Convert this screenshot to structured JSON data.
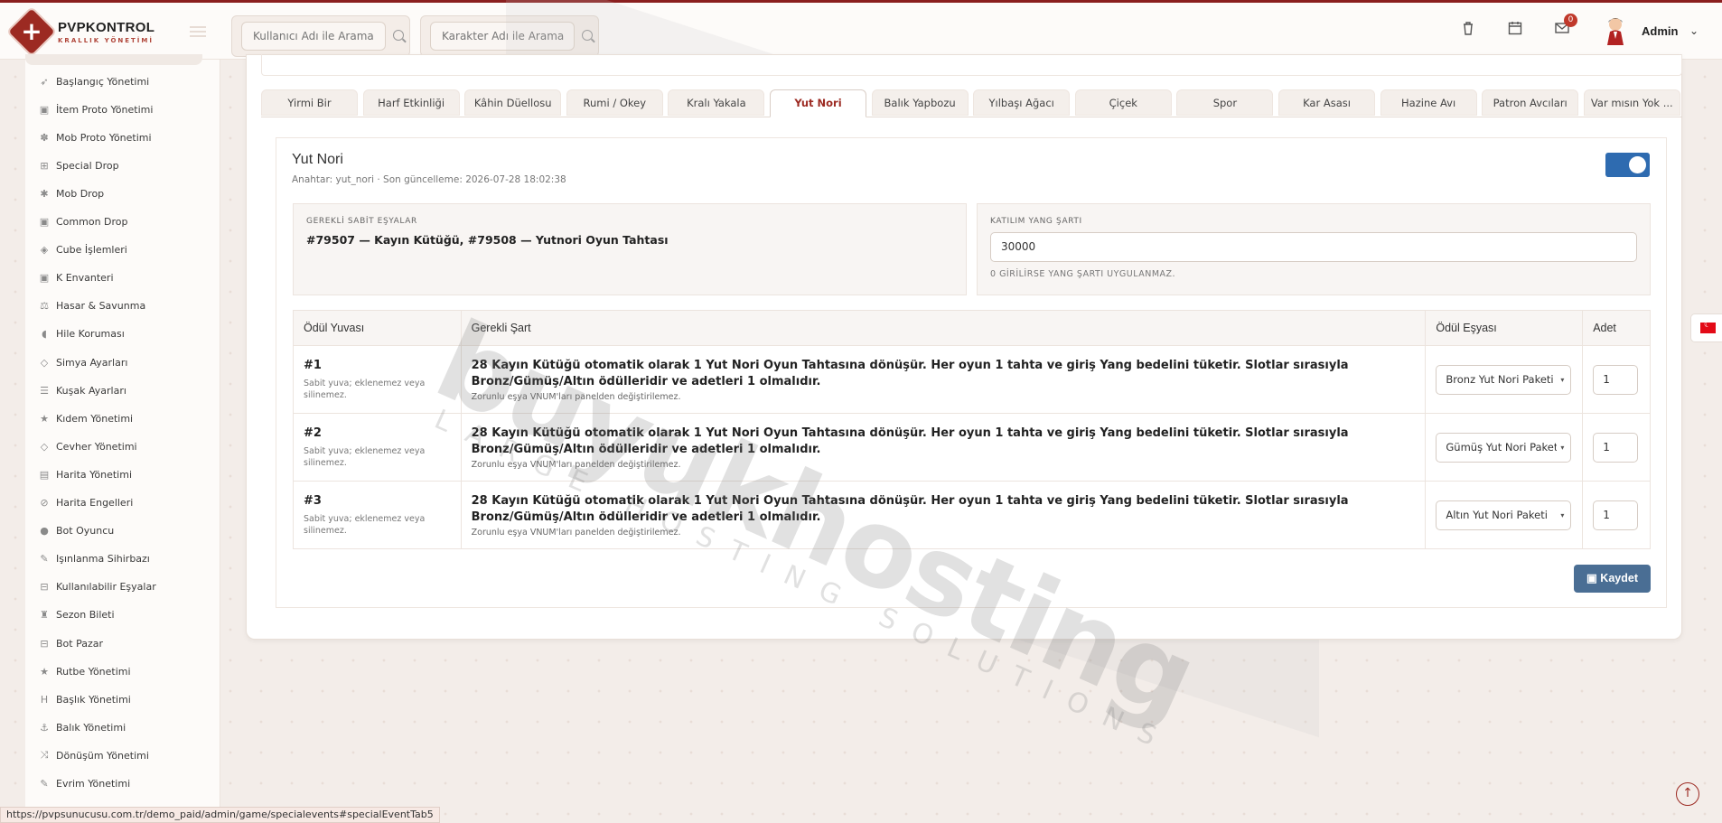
{
  "brand": {
    "title": "PVPKONTROL",
    "subtitle": "KRALLIK YÖNETİMİ"
  },
  "header": {
    "search_user_placeholder": "Kullanıcı Adı ile Arama",
    "search_char_placeholder": "Karakter Adı ile Arama",
    "notification_count": "0",
    "admin_name": "Admin"
  },
  "sidebar": {
    "items": [
      {
        "label": "Başlangıç Yönetimi",
        "icon": "rocket-icon"
      },
      {
        "label": "İtem Proto Yönetimi",
        "icon": "box-icon"
      },
      {
        "label": "Mob Proto Yönetimi",
        "icon": "paw-icon"
      },
      {
        "label": "Special Drop",
        "icon": "gift-icon"
      },
      {
        "label": "Mob Drop",
        "icon": "bug-icon"
      },
      {
        "label": "Common Drop",
        "icon": "box-icon"
      },
      {
        "label": "Cube İşlemleri",
        "icon": "cube-icon"
      },
      {
        "label": "K Envanteri",
        "icon": "box-icon"
      },
      {
        "label": "Hasar & Savunma",
        "icon": "scale-icon"
      },
      {
        "label": "Hile Koruması",
        "icon": "shield-icon"
      },
      {
        "label": "Simya Ayarları",
        "icon": "gem-icon"
      },
      {
        "label": "Kuşak Ayarları",
        "icon": "sliders-icon"
      },
      {
        "label": "Kıdem Yönetimi",
        "icon": "star-icon"
      },
      {
        "label": "Cevher Yönetimi",
        "icon": "gem-icon"
      },
      {
        "label": "Harita Yönetimi",
        "icon": "map-icon"
      },
      {
        "label": "Harita Engelleri",
        "icon": "ban-icon"
      },
      {
        "label": "Bot Oyuncu",
        "icon": "user-icon"
      },
      {
        "label": "Işınlanma Sihirbazı",
        "icon": "wand-icon"
      },
      {
        "label": "Kullanılabilir Eşyalar",
        "icon": "cart-icon"
      },
      {
        "label": "Sezon Bileti",
        "icon": "trophy-icon"
      },
      {
        "label": "Bot Pazar",
        "icon": "cart-icon"
      },
      {
        "label": "Rutbe Yönetimi",
        "icon": "star-icon"
      },
      {
        "label": "Başlık Yönetimi",
        "icon": "heading-icon"
      },
      {
        "label": "Balık Yönetimi",
        "icon": "anchor-icon"
      },
      {
        "label": "Dönüşüm Yönetimi",
        "icon": "shuffle-icon"
      },
      {
        "label": "Evrim Yönetimi",
        "icon": "wand-icon"
      }
    ]
  },
  "tabs": [
    {
      "label": "Yirmi Bir"
    },
    {
      "label": "Harf Etkinliği"
    },
    {
      "label": "Kâhin Düellosu"
    },
    {
      "label": "Rumi / Okey"
    },
    {
      "label": "Kralı Yakala"
    },
    {
      "label": "Yut Nori",
      "active": true
    },
    {
      "label": "Balık Yapbozu"
    },
    {
      "label": "Yılbaşı Ağacı"
    },
    {
      "label": "Çiçek"
    },
    {
      "label": "Spor"
    },
    {
      "label": "Kar Asası"
    },
    {
      "label": "Hazine Avı"
    },
    {
      "label": "Patron Avcıları"
    },
    {
      "label": "Var mısın Yok ..."
    }
  ],
  "event": {
    "title": "Yut Nori",
    "meta": "Anahtar: yut_nori · Son güncelleme: 2026-07-28 18:02:38",
    "enabled": true,
    "required_label": "GEREKLİ SABİT EŞYALAR",
    "required_items": "#79507 — Kayın Kütüğü, #79508 — Yutnori Oyun Tahtası",
    "yang_label": "KATILIM YANG ŞARTI",
    "yang_value": "30000",
    "yang_hint": "0 GİRİLİRSE YANG ŞARTI UYGULANMAZ."
  },
  "table": {
    "headers": [
      "Ödül Yuvası",
      "Gerekli Şart",
      "Ödül Eşyası",
      "Adet"
    ],
    "rows": [
      {
        "slot": "#1",
        "slot_note": "Sabit yuva; eklenemez veya silinemez.",
        "condition": "28 Kayın Kütüğü otomatik olarak 1 Yut Nori Oyun Tahtasına dönüşür. Her oyun 1 tahta ve giriş Yang bedelini tüketir. Slotlar sırasıyla Bronz/Gümüş/Altın ödülleridir ve adetleri 1 olmalıdır.",
        "condition_note": "Zorunlu eşya VNUM'ları panelden değiştirilemez.",
        "item": "Bronz Yut Nori Paketi",
        "qty": "1"
      },
      {
        "slot": "#2",
        "slot_note": "Sabit yuva; eklenemez veya silinemez.",
        "condition": "28 Kayın Kütüğü otomatik olarak 1 Yut Nori Oyun Tahtasına dönüşür. Her oyun 1 tahta ve giriş Yang bedelini tüketir. Slotlar sırasıyla Bronz/Gümüş/Altın ödülleridir ve adetleri 1 olmalıdır.",
        "condition_note": "Zorunlu eşya VNUM'ları panelden değiştirilemez.",
        "item": "Gümüş Yut Nori Paketi",
        "qty": "1"
      },
      {
        "slot": "#3",
        "slot_note": "Sabit yuva; eklenemez veya silinemez.",
        "condition": "28 Kayın Kütüğü otomatik olarak 1 Yut Nori Oyun Tahtasına dönüşür. Her oyun 1 tahta ve giriş Yang bedelini tüketir. Slotlar sırasıyla Bronz/Gümüş/Altın ödülleridir ve adetleri 1 olmalıdır.",
        "condition_note": "Zorunlu eşya VNUM'ları panelden değiştirilemez.",
        "item": "Altın Yut Nori Paketi",
        "qty": "1"
      }
    ]
  },
  "save_label": "Kaydet",
  "watermark": {
    "big": "buyukhosting",
    "small": "LARGE HOSTING SOLUTIONS"
  },
  "status_url": "https://pvpsunucusu.com.tr/demo_paid/admin/game/specialevents#specialEventTab5",
  "colors": {
    "accent": "#9c2a22",
    "toggle": "#2e6bb0",
    "save": "#4a6e94"
  }
}
